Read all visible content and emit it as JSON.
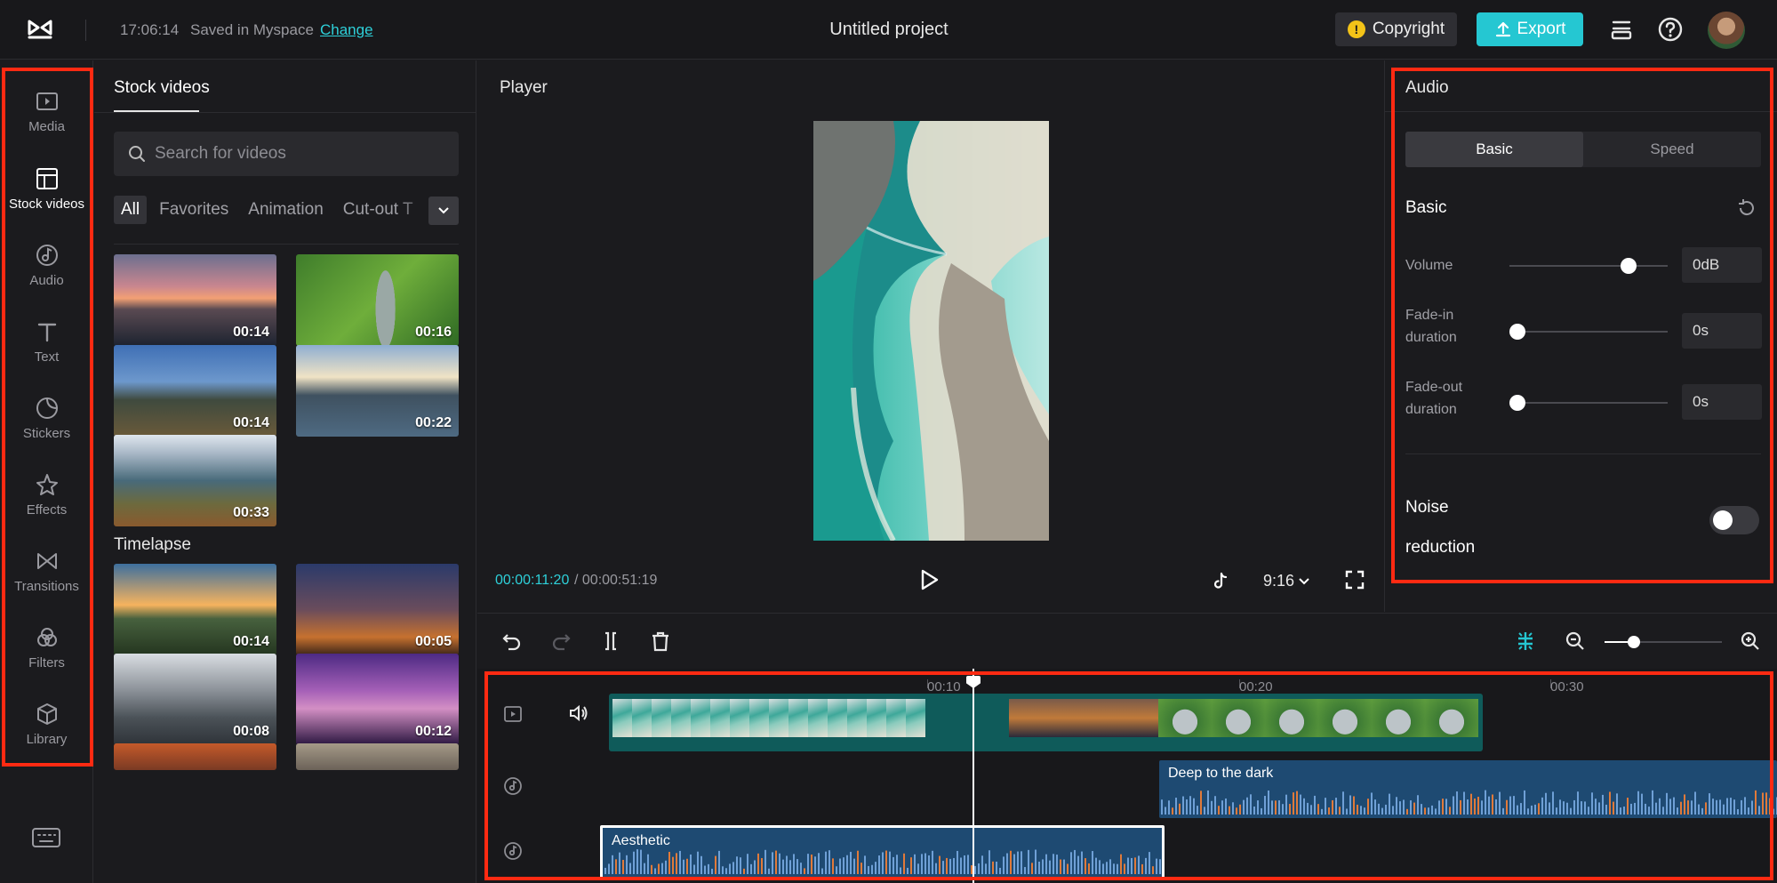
{
  "header": {
    "save_time": "17:06:14",
    "save_text": "Saved in Myspace",
    "change_label": "Change",
    "project_title": "Untitled project",
    "copyright_label": "Copyright",
    "export_label": "Export"
  },
  "nav": {
    "items": [
      {
        "label": "Media"
      },
      {
        "label": "Stock videos"
      },
      {
        "label": "Audio"
      },
      {
        "label": "Text"
      },
      {
        "label": "Stickers"
      },
      {
        "label": "Effects"
      },
      {
        "label": "Transitions"
      },
      {
        "label": "Filters"
      },
      {
        "label": "Library"
      }
    ],
    "active": "Stock videos"
  },
  "stock": {
    "title": "Stock videos",
    "search_placeholder": "Search for videos",
    "filters": [
      "All",
      "Favorites",
      "Animation",
      "Cut-out T"
    ],
    "section_timelapse": "Timelapse",
    "thumbs": [
      {
        "duration": "00:14"
      },
      {
        "duration": "00:16"
      },
      {
        "duration": "00:14"
      },
      {
        "duration": "00:22"
      },
      {
        "duration": "00:33"
      },
      {
        "duration": "00:14"
      },
      {
        "duration": "00:05"
      },
      {
        "duration": "00:08"
      },
      {
        "duration": "00:12"
      }
    ]
  },
  "player": {
    "title": "Player",
    "current_time": "00:00:11:20",
    "total_time": "/ 00:00:51:19",
    "aspect_ratio": "9:16"
  },
  "audio_panel": {
    "title": "Audio",
    "tabs": [
      "Basic",
      "Speed"
    ],
    "active_tab": "Basic",
    "section_title": "Basic",
    "volume_label": "Volume",
    "volume_value": "0dB",
    "volume_level": 0.75,
    "fadein_label_1": "Fade-in",
    "fadein_label_2": "duration",
    "fadein_value": "0s",
    "fadeout_label_1": "Fade-out",
    "fadeout_label_2": "duration",
    "fadeout_value": "0s",
    "noise_label_1": "Noise",
    "noise_label_2": "reduction",
    "noise_enabled": false
  },
  "timeline": {
    "ruler": [
      "00:10",
      "00:20",
      "00:30"
    ],
    "audio_clips": [
      "Deep to the dark",
      "Aesthetic"
    ],
    "zoom_level": 0.25
  },
  "colors": {
    "accent": "#25c7d2",
    "highlight_border": "#ff2a12",
    "audio_clip": "#1e4a72"
  }
}
